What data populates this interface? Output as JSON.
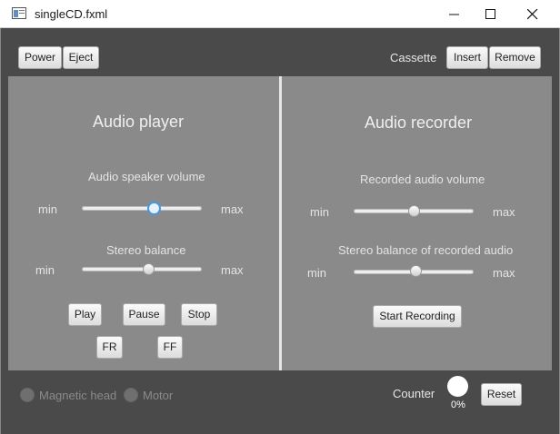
{
  "window": {
    "title": "singleCD.fxml"
  },
  "toolbar": {
    "power_label": "Power",
    "eject_label": "Eject",
    "cassette_label": "Cassette",
    "insert_label": "Insert",
    "remove_label": "Remove"
  },
  "player": {
    "title": "Audio player",
    "volume_label": "Audio speaker volume",
    "volume_min": "min",
    "volume_max": "max",
    "volume_value": 0.6,
    "balance_label": "Stereo balance",
    "balance_min": "min",
    "balance_max": "max",
    "balance_value": 0.56,
    "play_label": "Play",
    "pause_label": "Pause",
    "stop_label": "Stop",
    "fr_label": "FR",
    "ff_label": "FF"
  },
  "recorder": {
    "title": "Audio recorder",
    "volume_label": "Recorded audio volume",
    "volume_min": "min",
    "volume_max": "max",
    "volume_value": 0.5,
    "balance_label": "Stereo balance of recorded audio",
    "balance_min": "min",
    "balance_max": "max",
    "balance_value": 0.52,
    "record_label": "Start Recording"
  },
  "status": {
    "magnetic_head_label": "Magnetic head",
    "motor_label": "Motor",
    "counter_label": "Counter",
    "counter_value": "0%",
    "reset_label": "Reset"
  }
}
